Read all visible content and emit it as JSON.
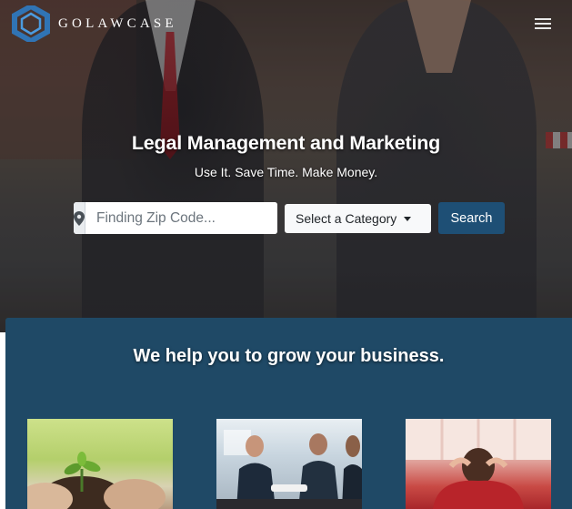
{
  "header": {
    "brand_name": "GOLAWCASE",
    "logo_icon": "hexagon-logo-icon",
    "menu_icon": "hamburger-menu-icon"
  },
  "hero": {
    "title": "Legal Management and Marketing",
    "subtitle": "Use It. Save Time. Make Money."
  },
  "search": {
    "zip_icon": "map-marker-icon",
    "zip_placeholder": "Finding Zip Code...",
    "category_label": "Select a Category",
    "search_label": "Search"
  },
  "services": {
    "title": "We help you to grow your business.",
    "cards": [
      {
        "image": "plant-in-hands-photo"
      },
      {
        "image": "business-handshake-photo"
      },
      {
        "image": "relaxing-man-photo"
      }
    ]
  },
  "colors": {
    "primary": "#1e4f75",
    "section_bg": "#1f4966",
    "logo_blue": "#2e7bc4"
  }
}
